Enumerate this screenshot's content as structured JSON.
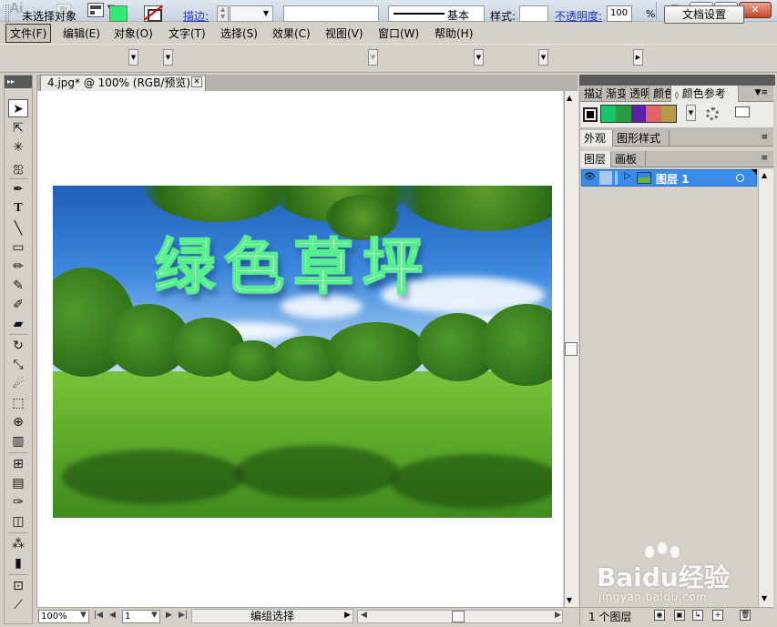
{
  "app": {
    "logo": "Ai",
    "bridge_label": "Br",
    "window_buttons": {
      "minimize": "▁",
      "maximize": "□",
      "close": "✕"
    }
  },
  "menu": [
    "文件(F)",
    "编辑(E)",
    "对象(O)",
    "文字(T)",
    "选择(S)",
    "效果(C)",
    "视图(V)",
    "窗口(W)",
    "帮助(H)"
  ],
  "control_bar": {
    "no_selection": "未选择对象",
    "fill_color": "#30ea73",
    "stroke_label": "描边:",
    "brush_label": "基本",
    "style_label": "样式:",
    "opacity_label": "不透明度:",
    "opacity_value": "100",
    "opacity_unit": "%",
    "doc_setup_button": "文档设置"
  },
  "tools": [
    "selection-tool",
    "direct-selection-tool",
    "magic-wand-tool",
    "lasso-tool",
    "pen-tool",
    "type-tool",
    "line-tool",
    "rectangle-tool",
    "paintbrush-tool",
    "pencil-tool",
    "blob-brush-tool",
    "eraser-tool",
    "rotate-tool",
    "scale-tool",
    "warp-tool",
    "free-transform-tool",
    "shape-builder-tool",
    "graph-tool",
    "mesh-tool",
    "gradient-tool",
    "eyedropper-tool",
    "blend-tool",
    "symbol-sprayer-tool",
    "column-graph-tool",
    "artboard-tool",
    "slice-tool"
  ],
  "document": {
    "tab_title": "4.jpg* @ 100% (RGB/预览)",
    "headline": "绿色草坪"
  },
  "status_bar": {
    "zoom": "100%",
    "page": "1",
    "status_text": "编组选择"
  },
  "panels": {
    "top_tabs": [
      "描边",
      "渐变",
      "透明",
      "颜色",
      "颜色参考"
    ],
    "guide_colors": [
      "#18c46a",
      "#2a9b3e",
      "#5b1fa8",
      "#e06468",
      "#b59a48"
    ],
    "mid_tabs": [
      "外观",
      "图形样式"
    ],
    "layer_tabs": [
      "图层",
      "画板"
    ],
    "layer_name": "图层 1",
    "layer_count": "1 个图层"
  },
  "watermark": {
    "text": "Baidu经验",
    "url": "jingyan.baidu.com"
  }
}
